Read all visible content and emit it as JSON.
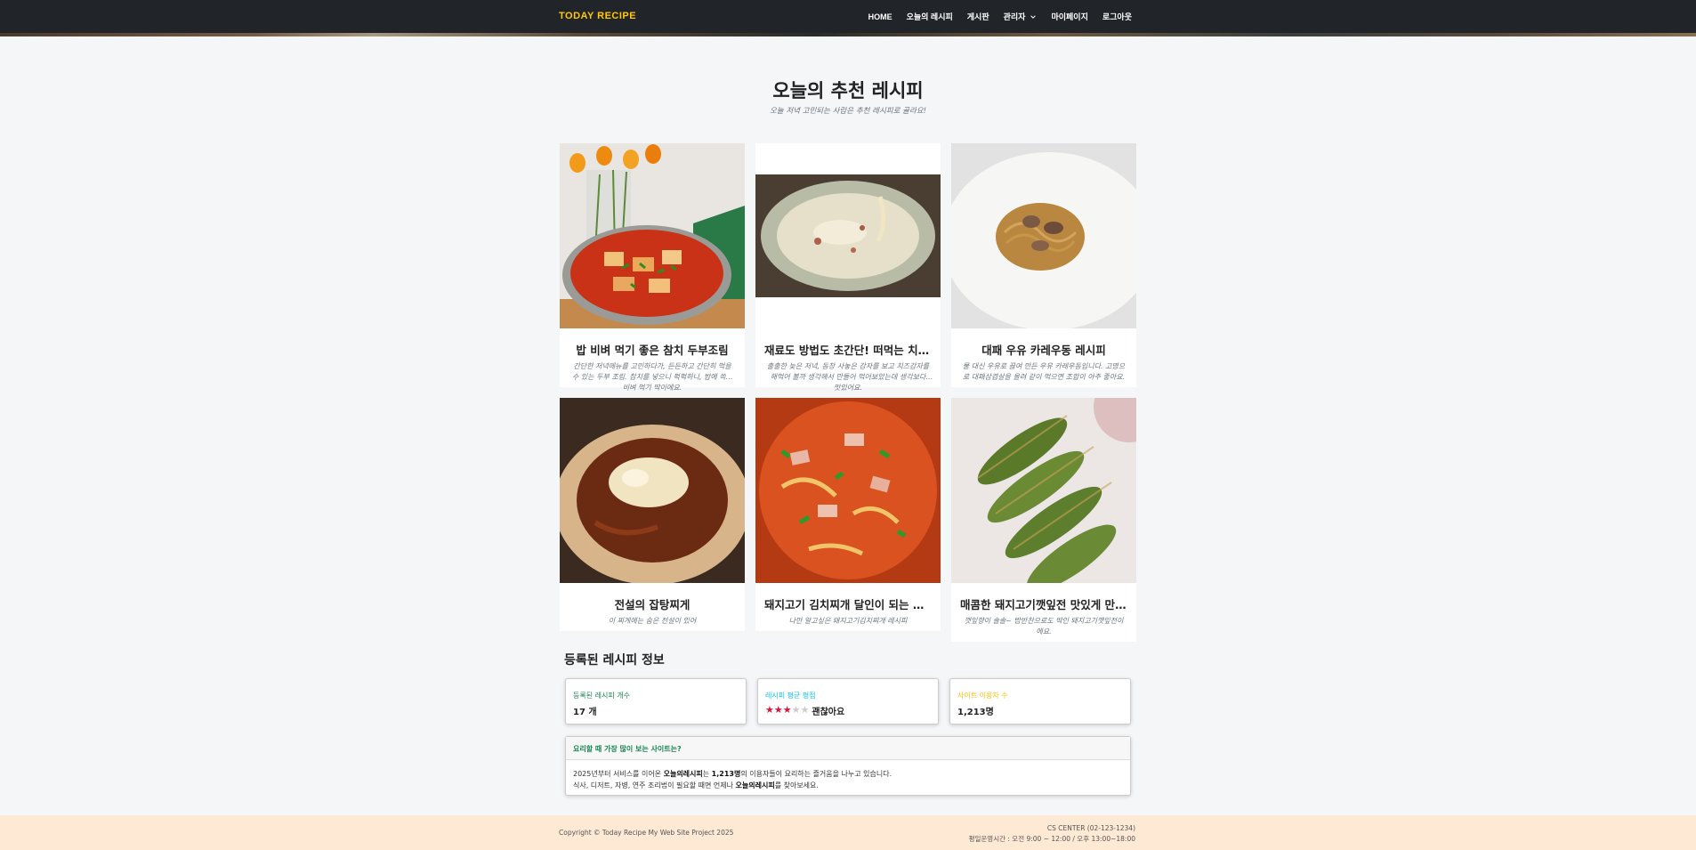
{
  "nav": {
    "brand": "TODAY RECIPE",
    "links": [
      "HOME",
      "오늘의 레시피",
      "게시판",
      "관리자",
      "마이페이지",
      "로그아웃"
    ]
  },
  "recommend": {
    "title": "오늘의 추천 레시피",
    "subtitle": "오늘 저녁 고민되는 사람은 추천 레시피로 골라요!",
    "cards": [
      {
        "title": "밥 비벼 먹기 좋은 참치 두부조림",
        "desc": "간단한 저녁메뉴를 고민하다가, 든든하고 간단히 먹을 수 있는 두부 조림. 참치를 넣으니 퍽퍽하니, 밥에 쓱쓱 비벼 먹기 딱이에요."
      },
      {
        "title": "재료도 방법도 초간단! 떠먹는 치즈피자",
        "desc": "출출한 늦은 저녁, 동창 사놓은 감자를 보고 치즈감자를 해먹어 볼까 생각해서 만들어 먹어보았는데 생각보다 맛있어요."
      },
      {
        "title": "대패 우유 카레우동 레시피",
        "desc": "물 대신 우유로 끓여 만든 우유 카레우동입니다. 고명으로 대패삼겹살을 올려 같이 먹으면 조합이 아주 좋아요."
      },
      {
        "title": "전설의 잡탕찌게",
        "desc": "이 찌게에는 숨은 전설이 있어"
      },
      {
        "title": "돼지고기 김치찌개 달인이 되는 황금레시피",
        "desc": "나만 알고싶은 돼지고기김치찌개 레시피"
      },
      {
        "title": "매콤한 돼지고기깻잎전 맛있게 만드는 법",
        "desc": "깻잎향이 솔솔~ 밥반찬으로도 딱인 돼지고기깻잎전이에요."
      }
    ]
  },
  "info": {
    "title": "등록된 레시피 정보",
    "stats": [
      {
        "label": "등록된 레시피 개수",
        "value": "17 개",
        "color": "#198754"
      },
      {
        "label": "레시피 평균 평점",
        "value": "괜찮아요",
        "rating": 3,
        "max": 5,
        "color": "#0dcaf0"
      },
      {
        "label": "사이트 이용자 수",
        "value": "1,213명",
        "color": "#ffc107"
      }
    ],
    "faq": {
      "question": "요리할 때 가장 많이 보는 사이트는?",
      "line1_a": "2025년부터 서비스를 이어온 ",
      "line1_b": "오늘의레시피",
      "line1_c": "는 ",
      "line1_d": "1,213명",
      "line1_e": "의 이용자들이 요리하는 즐거움을 나누고 있습니다.",
      "line2_a": "식사, 디저트, 자병, 연주 조리법이 필요할 때면 언제나 ",
      "line2_b": "오늘의레시피",
      "line2_c": "를 찾아보세요."
    }
  },
  "footer": {
    "copyright": "Copyright © Today Recipe My Web Site Project 2025",
    "cs_center": "CS CENTER (02-123-1234)",
    "hours": "평일운영시간 : 오전 9:00 ~ 12:00 / 오후 13:00~18:00"
  },
  "colors": {
    "navbar": "#212529",
    "brand": "#ffc800",
    "footer": "#fde9d4",
    "star_on": "#dc143c",
    "star_off": "#cccccc"
  }
}
